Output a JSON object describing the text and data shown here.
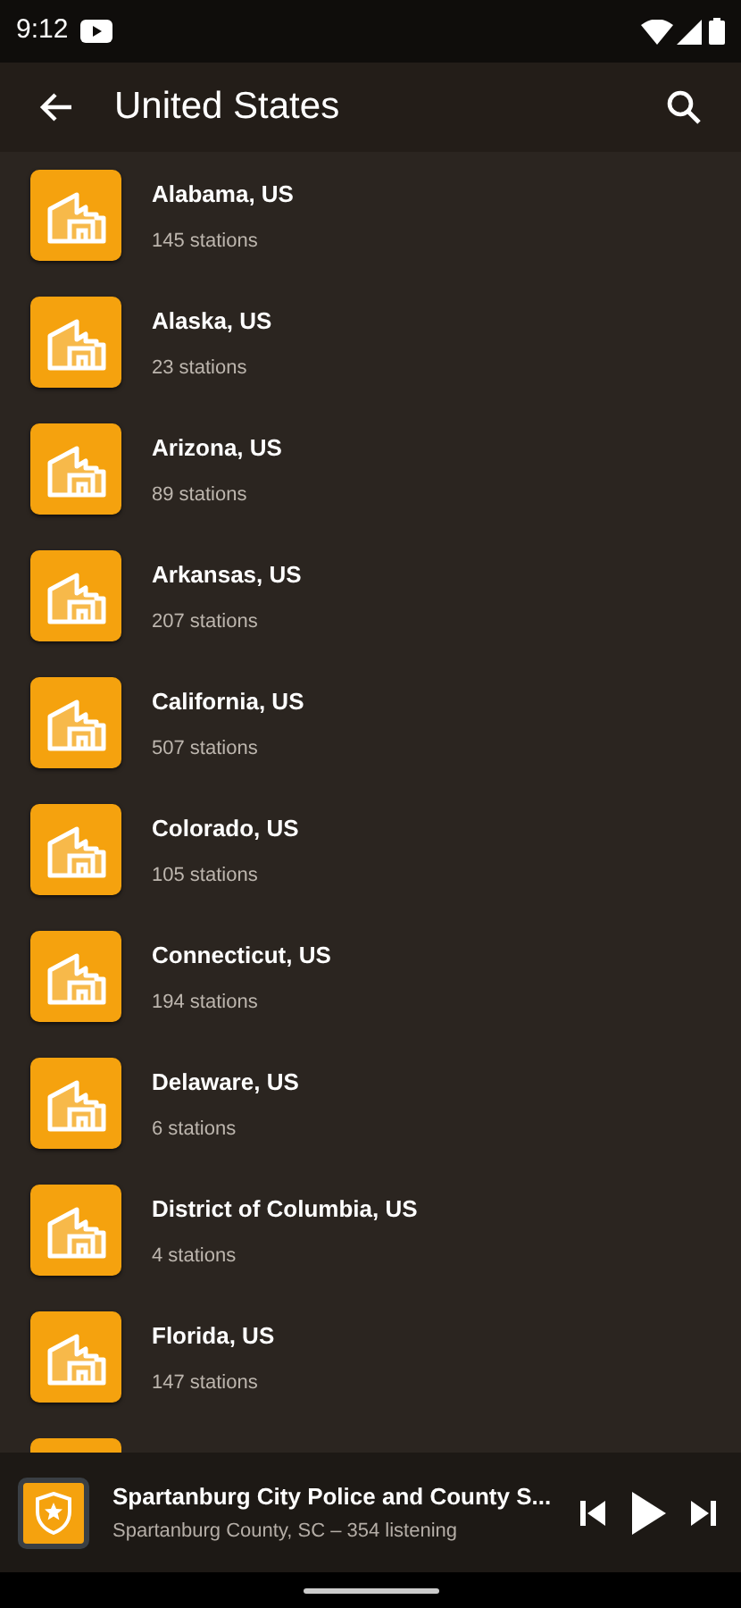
{
  "status_bar": {
    "time": "9:12"
  },
  "app_bar": {
    "title": "United States"
  },
  "regions": [
    {
      "name": "Alabama, US",
      "stations": "145 stations"
    },
    {
      "name": "Alaska, US",
      "stations": "23 stations"
    },
    {
      "name": "Arizona, US",
      "stations": "89 stations"
    },
    {
      "name": "Arkansas, US",
      "stations": "207 stations"
    },
    {
      "name": "California, US",
      "stations": "507 stations"
    },
    {
      "name": "Colorado, US",
      "stations": "105 stations"
    },
    {
      "name": "Connecticut, US",
      "stations": "194 stations"
    },
    {
      "name": "Delaware, US",
      "stations": "6 stations"
    },
    {
      "name": "District of Columbia, US",
      "stations": "4 stations"
    },
    {
      "name": "Florida, US",
      "stations": "147 stations"
    }
  ],
  "player": {
    "title": "Spartanburg City Police and County S...",
    "subtitle": "Spartanburg County, SC – 354 listening",
    "playing": false
  }
}
